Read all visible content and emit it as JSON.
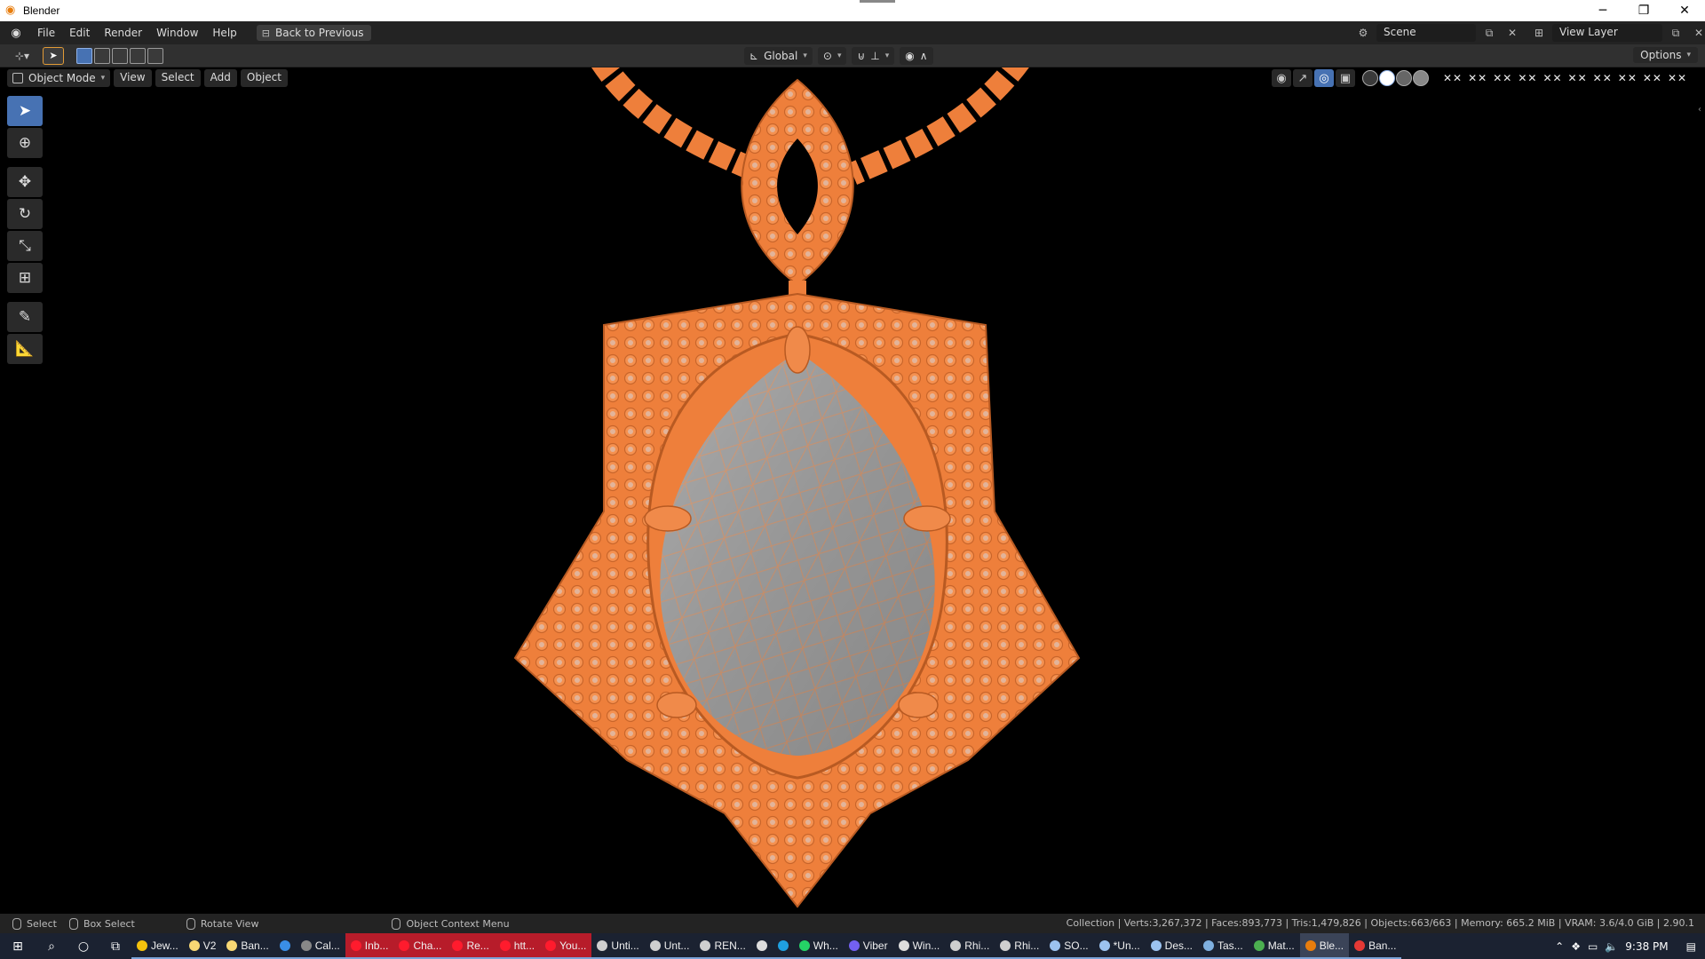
{
  "window": {
    "title": "Blender"
  },
  "topbar": {
    "menus": [
      "File",
      "Edit",
      "Render",
      "Window",
      "Help"
    ],
    "back_button": "Back to Previous",
    "scene_name": "Scene",
    "view_layer": "View Layer"
  },
  "header": {
    "orientation": "Global",
    "options": "Options"
  },
  "viewport": {
    "mode": "Object Mode",
    "menus": [
      "View",
      "Select",
      "Add",
      "Object"
    ],
    "overlay_x_marks": [
      "✕✕",
      "✕✕",
      "✕✕",
      "✕✕",
      "✕✕",
      "✕✕",
      "✕✕",
      "✕✕",
      "✕✕",
      "✕✕"
    ]
  },
  "colors": {
    "accent_blue": "#4772b3",
    "mesh_orange": "#f0843f",
    "gem_gray": "#9a9a9a",
    "active_tool_outline": "#e29b36"
  },
  "statusbar": {
    "left_action": "Select",
    "middle_action": "Box Select",
    "rotate_action": "Rotate View",
    "context_action": "Object Context Menu",
    "stats": "Collection | Verts:3,267,372 | Faces:893,773 | Tris:1,479,826 | Objects:663/663 | Memory: 665.2 MiB | VRAM: 3.6/4.0 GiB | 2.90.1"
  },
  "taskbar": {
    "apps": [
      {
        "label": "Jew...",
        "style": "normal",
        "icon": "chrome-icon"
      },
      {
        "label": "V2",
        "style": "normal",
        "icon": "folder-icon"
      },
      {
        "label": "Ban...",
        "style": "normal",
        "icon": "folder-icon"
      },
      {
        "label": "",
        "style": "normal",
        "icon": "mail-icon"
      },
      {
        "label": "Cal...",
        "style": "normal",
        "icon": "calculator-icon"
      },
      {
        "label": "Inb...",
        "style": "red",
        "icon": "opera-icon"
      },
      {
        "label": "Cha...",
        "style": "red",
        "icon": "opera-icon"
      },
      {
        "label": "Re...",
        "style": "red",
        "icon": "opera-icon"
      },
      {
        "label": "htt...",
        "style": "red",
        "icon": "opera-icon"
      },
      {
        "label": "You...",
        "style": "red",
        "icon": "opera-icon"
      },
      {
        "label": "Unti...",
        "style": "normal",
        "icon": "rhino-icon"
      },
      {
        "label": "Unt...",
        "style": "normal",
        "icon": "rhino-icon"
      },
      {
        "label": "REN...",
        "style": "normal",
        "icon": "rhino-icon"
      },
      {
        "label": "",
        "style": "normal",
        "icon": "obs-icon"
      },
      {
        "label": "",
        "style": "normal",
        "icon": "edge-icon"
      },
      {
        "label": "Wh...",
        "style": "normal",
        "icon": "whatsapp-icon"
      },
      {
        "label": "Viber",
        "style": "normal",
        "icon": "viber-icon"
      },
      {
        "label": "Win...",
        "style": "normal",
        "icon": "shield-icon"
      },
      {
        "label": "Rhi...",
        "style": "normal",
        "icon": "rhino-icon"
      },
      {
        "label": "Rhi...",
        "style": "normal",
        "icon": "rhino-icon"
      },
      {
        "label": "SO...",
        "style": "normal",
        "icon": "document-icon"
      },
      {
        "label": "*Un...",
        "style": "normal",
        "icon": "document-icon"
      },
      {
        "label": "Des...",
        "style": "normal",
        "icon": "document-icon"
      },
      {
        "label": "Tas...",
        "style": "normal",
        "icon": "taskmgr-icon"
      },
      {
        "label": "Mat...",
        "style": "normal",
        "icon": "chart-icon"
      },
      {
        "label": "Ble...",
        "style": "active",
        "icon": "blender-icon"
      },
      {
        "label": "Ban...",
        "style": "normal",
        "icon": "record-icon"
      }
    ],
    "clock": "9:38 PM"
  }
}
